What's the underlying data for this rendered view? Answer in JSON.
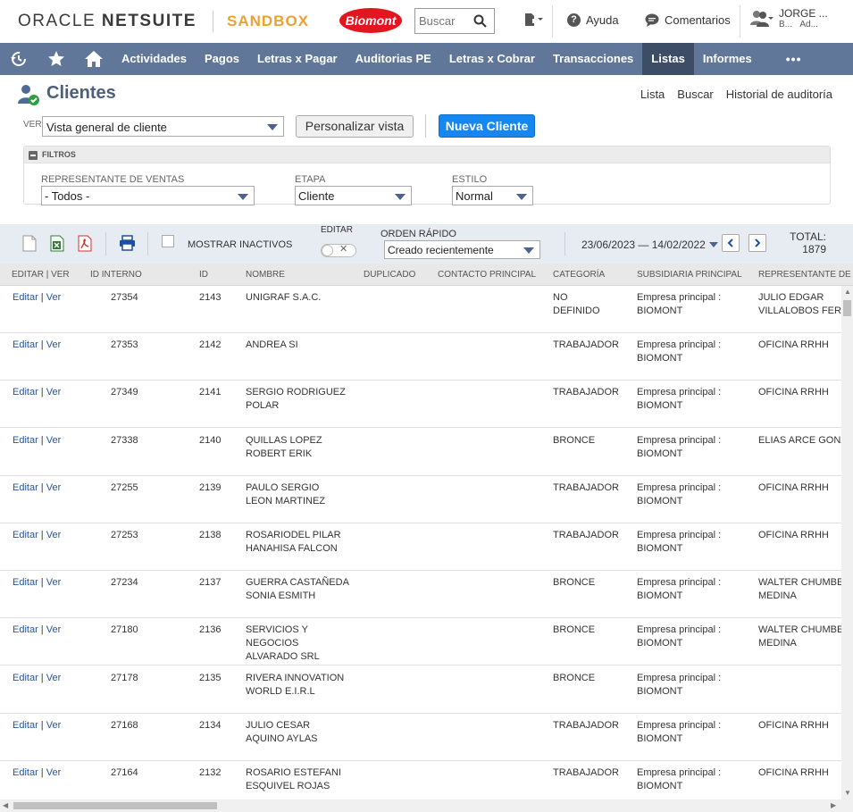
{
  "header": {
    "oracle": "ORACLE",
    "netsuite": "NETSUITE",
    "env_label": "SANDBOX",
    "brand": "Biomont",
    "search_placeholder": "Buscar",
    "help": "Ayuda",
    "feedback": "Comentarios",
    "user_name": "JORGE ...",
    "user_line2a": "B...",
    "user_line2b": "Ad..."
  },
  "nav": {
    "items": [
      "Actividades",
      "Pagos",
      "Letras x Pagar",
      "Auditorias PE",
      "Letras x Cobrar",
      "Transacciones",
      "Listas",
      "Informes"
    ],
    "active": "Listas",
    "more": "•••"
  },
  "page": {
    "title": "Clientes",
    "links": [
      "Lista",
      "Buscar",
      "Historial de auditoría"
    ],
    "view_label": "VER",
    "view_value": "Vista general de cliente",
    "customize_btn": "Personalizar vista",
    "new_btn": "Nueva Cliente"
  },
  "filters": {
    "title": "FILTROS",
    "rep_label": "REPRESENTANTE DE VENTAS",
    "rep_value": "- Todos -",
    "stage_label": "ETAPA",
    "stage_value": "Cliente",
    "style_label": "ESTILO",
    "style_value": "Normal"
  },
  "toolbar": {
    "show_inactive": "MOSTRAR INACTIVOS",
    "edit_label": "EDITAR",
    "quick_sort_label": "ORDEN RÁPIDO",
    "quick_sort_value": "Creado recientemente",
    "date_range": "23/06/2023 — 14/02/2022",
    "total_label": "TOTAL:",
    "total_value": "1879"
  },
  "table": {
    "headers": [
      "EDITAR | VER",
      "ID INTERNO",
      "ID",
      "NOMBRE",
      "DUPLICADO",
      "CONTACTO PRINCIPAL",
      "CATEGORÍA",
      "SUBSIDIARIA PRINCIPAL",
      "REPRESENTANTE DE VE"
    ],
    "edit_text": "Editar",
    "view_text": "Ver",
    "rows": [
      {
        "internal_id": "27354",
        "id": "2143",
        "name": [
          "UNIGRAF S.A.C."
        ],
        "category": [
          "NO",
          "DEFINIDO"
        ],
        "subsidiary": [
          "Empresa principal :",
          "BIOMONT"
        ],
        "rep": [
          "JULIO EDGAR",
          "VILLALOBOS FERN"
        ]
      },
      {
        "internal_id": "27353",
        "id": "2142",
        "name": [
          "ANDREA SI"
        ],
        "category": [
          "TRABAJADOR"
        ],
        "subsidiary": [
          "Empresa principal :",
          "BIOMONT"
        ],
        "rep": [
          "OFICINA RRHH"
        ]
      },
      {
        "internal_id": "27349",
        "id": "2141",
        "name": [
          "SERGIO RODRIGUEZ",
          "POLAR"
        ],
        "category": [
          "TRABAJADOR"
        ],
        "subsidiary": [
          "Empresa principal :",
          "BIOMONT"
        ],
        "rep": [
          "OFICINA RRHH"
        ]
      },
      {
        "internal_id": "27338",
        "id": "2140",
        "name": [
          "QUILLAS LOPEZ",
          "ROBERT ERIK"
        ],
        "category": [
          "BRONCE"
        ],
        "subsidiary": [
          "Empresa principal :",
          "BIOMONT"
        ],
        "rep": [
          "ELIAS ARCE GONZ"
        ]
      },
      {
        "internal_id": "27255",
        "id": "2139",
        "name": [
          "PAULO SERGIO",
          "LEON MARTINEZ"
        ],
        "category": [
          "TRABAJADOR"
        ],
        "subsidiary": [
          "Empresa principal :",
          "BIOMONT"
        ],
        "rep": [
          "OFICINA RRHH"
        ]
      },
      {
        "internal_id": "27253",
        "id": "2138",
        "name": [
          "ROSARIODEL PILAR",
          "HANAHISA FALCON"
        ],
        "category": [
          "TRABAJADOR"
        ],
        "subsidiary": [
          "Empresa principal :",
          "BIOMONT"
        ],
        "rep": [
          "OFICINA RRHH"
        ]
      },
      {
        "internal_id": "27234",
        "id": "2137",
        "name": [
          "GUERRA CASTAÑEDA",
          "SONIA ESMITH"
        ],
        "category": [
          "BRONCE"
        ],
        "subsidiary": [
          "Empresa principal :",
          "BIOMONT"
        ],
        "rep": [
          "WALTER CHUMBES",
          "MEDINA"
        ]
      },
      {
        "internal_id": "27180",
        "id": "2136",
        "name": [
          "SERVICIOS Y",
          "NEGOCIOS",
          "ALVARADO SRL"
        ],
        "category": [
          "BRONCE"
        ],
        "subsidiary": [
          "Empresa principal :",
          "BIOMONT"
        ],
        "rep": [
          "WALTER CHUMBES",
          "MEDINA"
        ]
      },
      {
        "internal_id": "27178",
        "id": "2135",
        "name": [
          "RIVERA INNOVATION",
          "WORLD E.I.R.L"
        ],
        "category": [
          "BRONCE"
        ],
        "subsidiary": [
          "Empresa principal :",
          "BIOMONT"
        ],
        "rep": []
      },
      {
        "internal_id": "27168",
        "id": "2134",
        "name": [
          "JULIO CESAR",
          "AQUINO AYLAS"
        ],
        "category": [
          "TRABAJADOR"
        ],
        "subsidiary": [
          "Empresa principal :",
          "BIOMONT"
        ],
        "rep": [
          "OFICINA RRHH"
        ]
      },
      {
        "internal_id": "27164",
        "id": "2132",
        "name": [
          "ROSARIO ESTEFANI",
          "ESQUIVEL ROJAS"
        ],
        "category": [
          "TRABAJADOR"
        ],
        "subsidiary": [
          "Empresa principal :",
          "BIOMONT"
        ],
        "rep": [
          "OFICINA RRHH"
        ]
      }
    ]
  },
  "colors": {
    "nav_bg": "#607799",
    "nav_active": "#3e4d66",
    "primary_btn": "#1687f0",
    "brand_red": "#e3161f",
    "sandbox": "#f0a030",
    "link": "#255599"
  }
}
